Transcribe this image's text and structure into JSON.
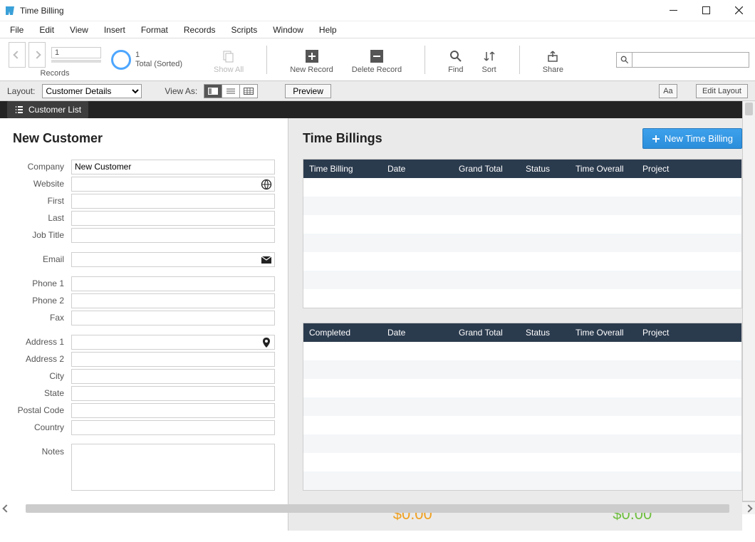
{
  "window": {
    "title": "Time Billing"
  },
  "menu": {
    "items": [
      "File",
      "Edit",
      "View",
      "Insert",
      "Format",
      "Records",
      "Scripts",
      "Window",
      "Help"
    ]
  },
  "toolbar": {
    "record_index": "1",
    "records_label": "Records",
    "record_count": "1",
    "total_sorted": "Total (Sorted)",
    "show_all": "Show All",
    "new_record": "New Record",
    "delete_record": "Delete Record",
    "find": "Find",
    "sort": "Sort",
    "share": "Share",
    "search_value": ""
  },
  "layoutbar": {
    "layout_label": "Layout:",
    "layout_selected": "Customer Details",
    "view_as": "View As:",
    "preview": "Preview",
    "aa": "Aa",
    "edit_layout": "Edit Layout"
  },
  "darkbar": {
    "customer_list": "Customer List"
  },
  "left": {
    "title": "New Customer",
    "labels": {
      "company": "Company",
      "website": "Website",
      "first": "First",
      "last": "Last",
      "job_title": "Job Title",
      "email": "Email",
      "phone1": "Phone 1",
      "phone2": "Phone 2",
      "fax": "Fax",
      "addr1": "Address 1",
      "addr2": "Address 2",
      "city": "City",
      "state": "State",
      "postal": "Postal Code",
      "country": "Country",
      "notes": "Notes"
    },
    "values": {
      "company": "New Customer",
      "website": "",
      "first": "",
      "last": "",
      "job_title": "",
      "email": "",
      "phone1": "",
      "phone2": "",
      "fax": "",
      "addr1": "",
      "addr2": "",
      "city": "",
      "state": "",
      "postal": "",
      "country": "",
      "notes": ""
    }
  },
  "right": {
    "title": "Time Billings",
    "new_btn": "New Time Billing",
    "table1": {
      "headers": [
        "Time Billing",
        "Date",
        "Grand Total",
        "Status",
        "Time Overall",
        "Project"
      ]
    },
    "table2": {
      "headers": [
        "Completed",
        "Date",
        "Grand Total",
        "Status",
        "Time Overall",
        "Project"
      ]
    },
    "total_pending": "$0.00",
    "total_done": "$0.00"
  }
}
